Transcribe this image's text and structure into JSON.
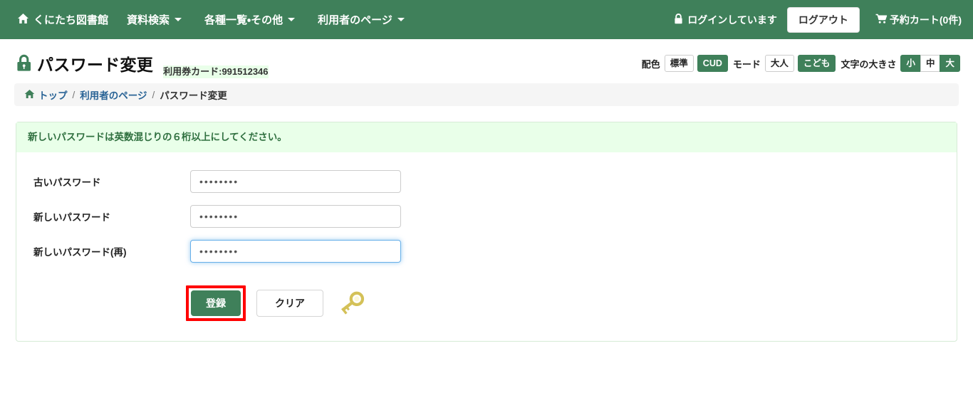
{
  "navbar": {
    "brand": "くにたち図書館",
    "brand_icon": "home-icon",
    "menu": [
      {
        "label": "資料検索",
        "caret": true
      },
      {
        "label": "各種一覧・その他",
        "caret": true
      },
      {
        "label": "利用者のページ",
        "caret": true
      }
    ],
    "login_status": "ログインしています",
    "login_status_icon": "lock-icon",
    "logout_label": "ログアウト",
    "cart_label": "予約カート(0件)",
    "cart_icon": "shopping-cart-icon",
    "background_color": "#3f805a"
  },
  "header": {
    "title": "パスワード変更",
    "title_icon": "padlock-icon",
    "card_label": "利用券カード:991512346"
  },
  "prefs": {
    "color_scheme_label": "配色",
    "color_scheme_options": [
      {
        "label": "標準",
        "active": false
      },
      {
        "label": "CUD",
        "active": true
      }
    ],
    "mode_label": "モード",
    "mode_options": [
      {
        "label": "大人",
        "active": false
      },
      {
        "label": "こども",
        "active": true
      }
    ],
    "text_size_label": "文字の大きさ",
    "text_size_options": [
      {
        "label": "小",
        "active": true
      },
      {
        "label": "中",
        "active": false
      },
      {
        "label": "大",
        "active": true
      }
    ],
    "accent_color": "#3f805a"
  },
  "breadcrumb": {
    "home_icon": "home-icon",
    "items": [
      {
        "label": "トップ",
        "link": true
      },
      {
        "label": "利用者のページ",
        "link": true
      },
      {
        "label": "パスワード変更",
        "link": false
      }
    ],
    "separator": "/"
  },
  "main": {
    "alert_text": "新しいパスワードは英数混じりの６桁以上にしてください。",
    "alert_bg": "#e9ffe9",
    "fields": [
      {
        "label": "古いパスワード",
        "value": "••••••••",
        "focused": false
      },
      {
        "label": "新しいパスワード",
        "value": "••••••••",
        "focused": false
      },
      {
        "label": "新しいパスワード(再)",
        "value": "••••••••",
        "focused": true
      }
    ],
    "submit_label": "登録",
    "clear_label": "クリア",
    "key_icon": "key-icon",
    "annotation_color": "#ff0000"
  }
}
